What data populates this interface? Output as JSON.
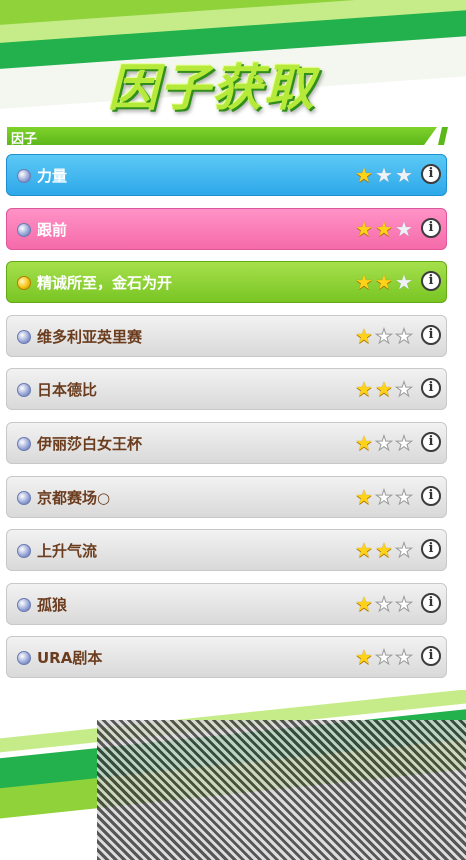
{
  "title": "因子获取",
  "section": {
    "label": "因子"
  },
  "factors": [
    {
      "name": "力量",
      "stars": 1,
      "max_stars": 3,
      "type": "blue"
    },
    {
      "name": "跟前",
      "stars": 2,
      "max_stars": 3,
      "type": "pink"
    },
    {
      "name": "精诚所至，金石为开",
      "stars": 2,
      "max_stars": 3,
      "type": "green"
    },
    {
      "name": "维多利亚英里赛",
      "stars": 1,
      "max_stars": 3,
      "type": "gray"
    },
    {
      "name": "日本德比",
      "stars": 2,
      "max_stars": 3,
      "type": "gray"
    },
    {
      "name": "伊丽莎白女王杯",
      "stars": 1,
      "max_stars": 3,
      "type": "gray"
    },
    {
      "name": "京都赛场○",
      "stars": 1,
      "max_stars": 3,
      "type": "gray"
    },
    {
      "name": "上升气流",
      "stars": 2,
      "max_stars": 3,
      "type": "gray"
    },
    {
      "name": "孤狼",
      "stars": 1,
      "max_stars": 3,
      "type": "gray"
    },
    {
      "name": "URA剧本",
      "stars": 1,
      "max_stars": 3,
      "type": "gray"
    }
  ],
  "icons": {
    "info": "info-icon",
    "star": "star-icon",
    "bullet": "bullet-icon"
  },
  "colors": {
    "accent_green": "#5cb71a",
    "blue": "#2ea8ea",
    "pink": "#f56aaa",
    "star": "#ffd21a",
    "label_dark": "#6b3d1e"
  }
}
